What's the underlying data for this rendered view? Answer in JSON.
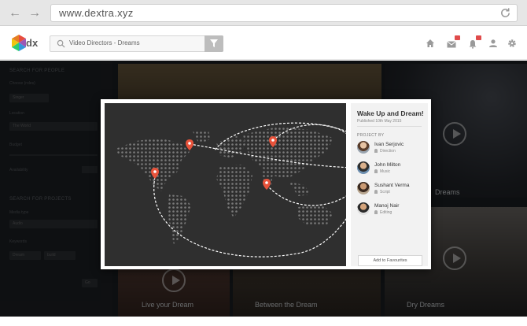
{
  "browser": {
    "url": "www.dextra.xyz"
  },
  "header": {
    "logo_text": "dx",
    "search_value": "Video Directors - Dreams",
    "icons": [
      "home-icon",
      "mail-icon",
      "bell-icon",
      "user-icon",
      "gear-icon"
    ],
    "badge_color": "#e04b4b"
  },
  "sidebar": {
    "search_people_heading": "SEARCH FOR PEOPLE",
    "choose_label": "Choose (roles)",
    "role_value": "Singer",
    "location_label": "Location",
    "location_value": "The World",
    "budget_label": "Budget",
    "availability_label": "Availability",
    "search_projects_heading": "SEARCH FOR PROJECTS",
    "media_type_label": "Media type",
    "media_value": "Audio",
    "keywords_label": "Keywords",
    "keyword_1": "Dream",
    "keyword_2": "build",
    "go_button": "Go"
  },
  "tiles": {
    "tile_1": "Live your Dream",
    "tile_2": "Between the Dream",
    "tile_3": "Dry Dreams",
    "tile_4": "Dreams"
  },
  "modal": {
    "title": "Wake Up and Dream!",
    "published": "Published 10th May 2015",
    "project_by_label": "PROJECT BY",
    "people": [
      {
        "name": "Ivan Serjovic",
        "role": "Direction"
      },
      {
        "name": "John Milton",
        "role": "Music"
      },
      {
        "name": "Sushant Verma",
        "role": "Script"
      },
      {
        "name": "Manoj Nair",
        "role": "Editing"
      }
    ],
    "fav_button": "Add to Favourites",
    "pin_color": "#e8533b"
  }
}
